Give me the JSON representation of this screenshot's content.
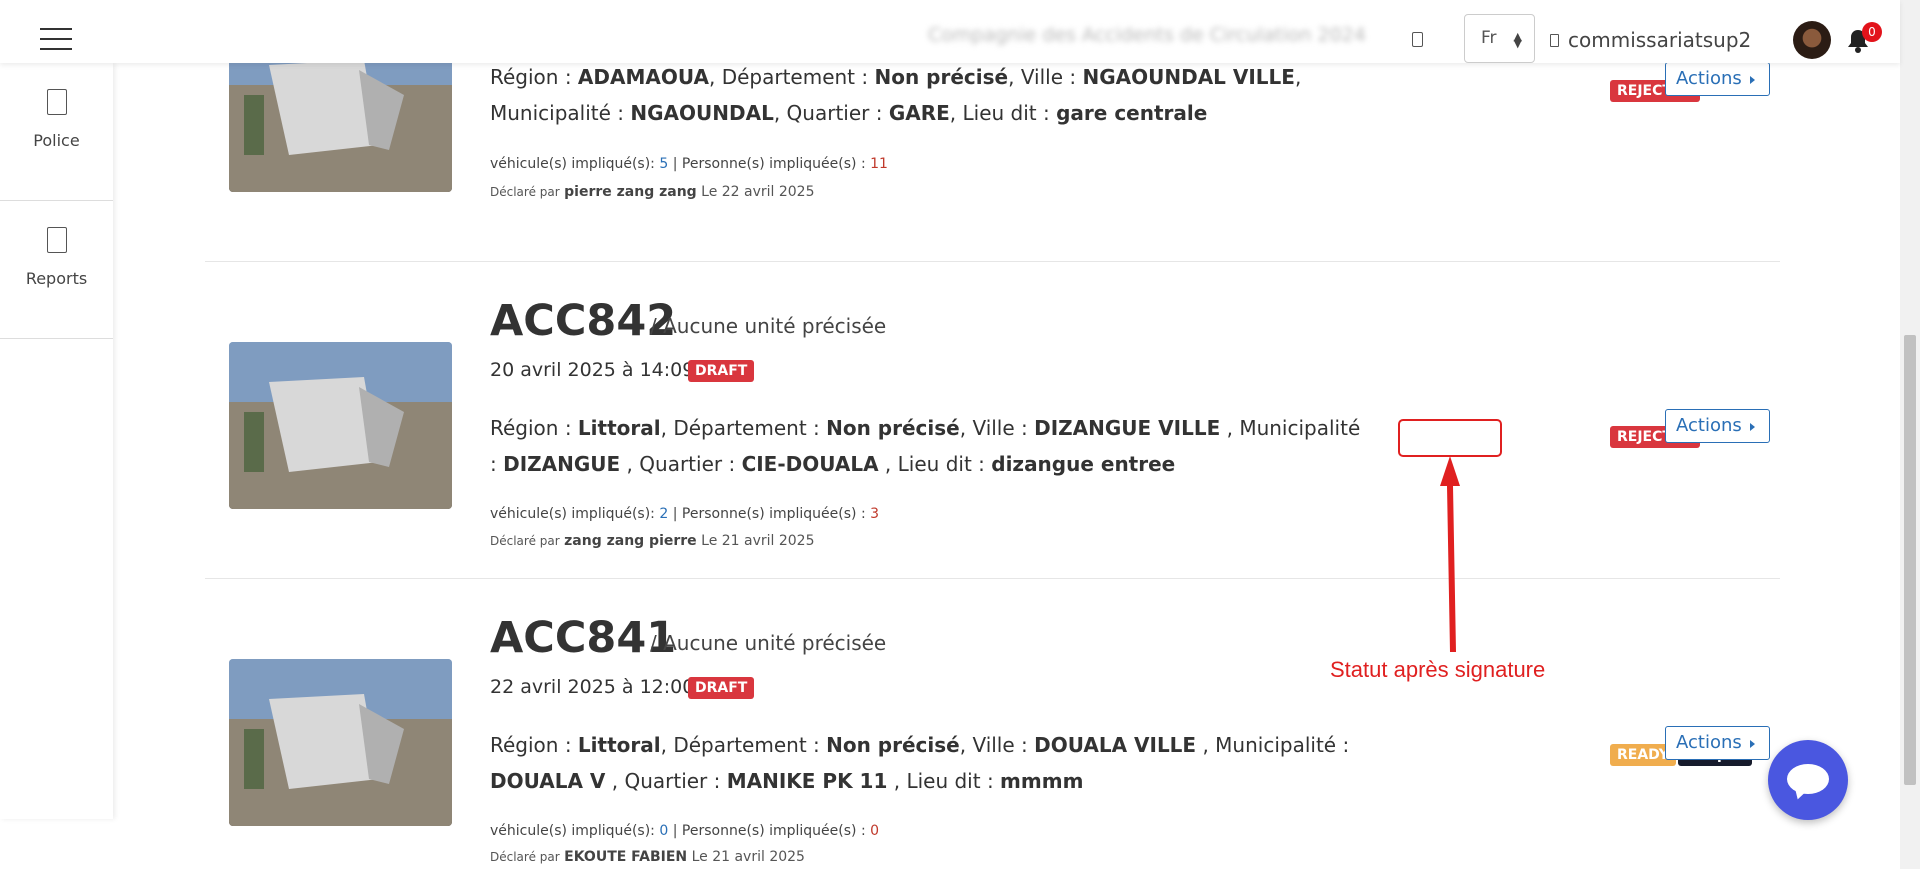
{
  "topbar": {
    "company": "Compagnie des Accidents de Circulation 2024",
    "language": "Fr",
    "username": "commissariatsup2",
    "notifications": "0"
  },
  "sidebar": {
    "items": [
      {
        "label": "Police"
      },
      {
        "label": "Reports"
      }
    ]
  },
  "labels": {
    "region": "Région",
    "departement": "Département",
    "ville": "Ville",
    "municipalite": "Municipalité",
    "quartier": "Quartier",
    "lieu_dit": "Lieu dit",
    "vehicules": "véhicule(s) impliqué(s):",
    "personnes": "Personne(s) impliquée(s) :",
    "declare_par": "Déclaré par",
    "actions": "Actions"
  },
  "accidents": [
    {
      "region": "ADAMAOUA",
      "departement": "Non précisé",
      "ville": "NGAOUNDAL VILLE",
      "municipalite": "NGAOUNDAL",
      "quartier": "GARE",
      "lieu_dit": "gare centrale",
      "vehicules": "5",
      "personnes": "11",
      "declared_by": "pierre zang zang",
      "declared_on": "Le 22 avril 2025",
      "status": "REJECTED"
    },
    {
      "code": "ACC842",
      "unit": "/ Aucune unité précisée",
      "date": "20 avril 2025 à 14:09",
      "draft": "DRAFT",
      "region": "Littoral",
      "departement": "Non précisé",
      "ville": "DIZANGUE VILLE",
      "municipalite": "DIZANGUE",
      "quartier": "CIE-DOUALA",
      "lieu_dit": "dizangue entree",
      "vehicules": "2",
      "personnes": "3",
      "declared_by": "zang zang pierre",
      "declared_on": "Le 21 avril 2025",
      "status": "REJECTED"
    },
    {
      "code": "ACC841",
      "unit": "/ Aucune unité précisée",
      "date": "22 avril 2025 à 12:00",
      "draft": "DRAFT",
      "region": "Littoral",
      "departement": "Non précisé",
      "ville": "DOUALA VILLE",
      "municipalite": "DOUALA V",
      "quartier": "MANIKE PK 11",
      "lieu_dit": "mmmm",
      "vehicules": "0",
      "personnes": "0",
      "declared_by": "EKOUTE FABIEN",
      "declared_on": "Le 21 avril 2025",
      "status": "READY",
      "extra_badge": "Croquis"
    }
  ],
  "annotation": "Statut après signature"
}
